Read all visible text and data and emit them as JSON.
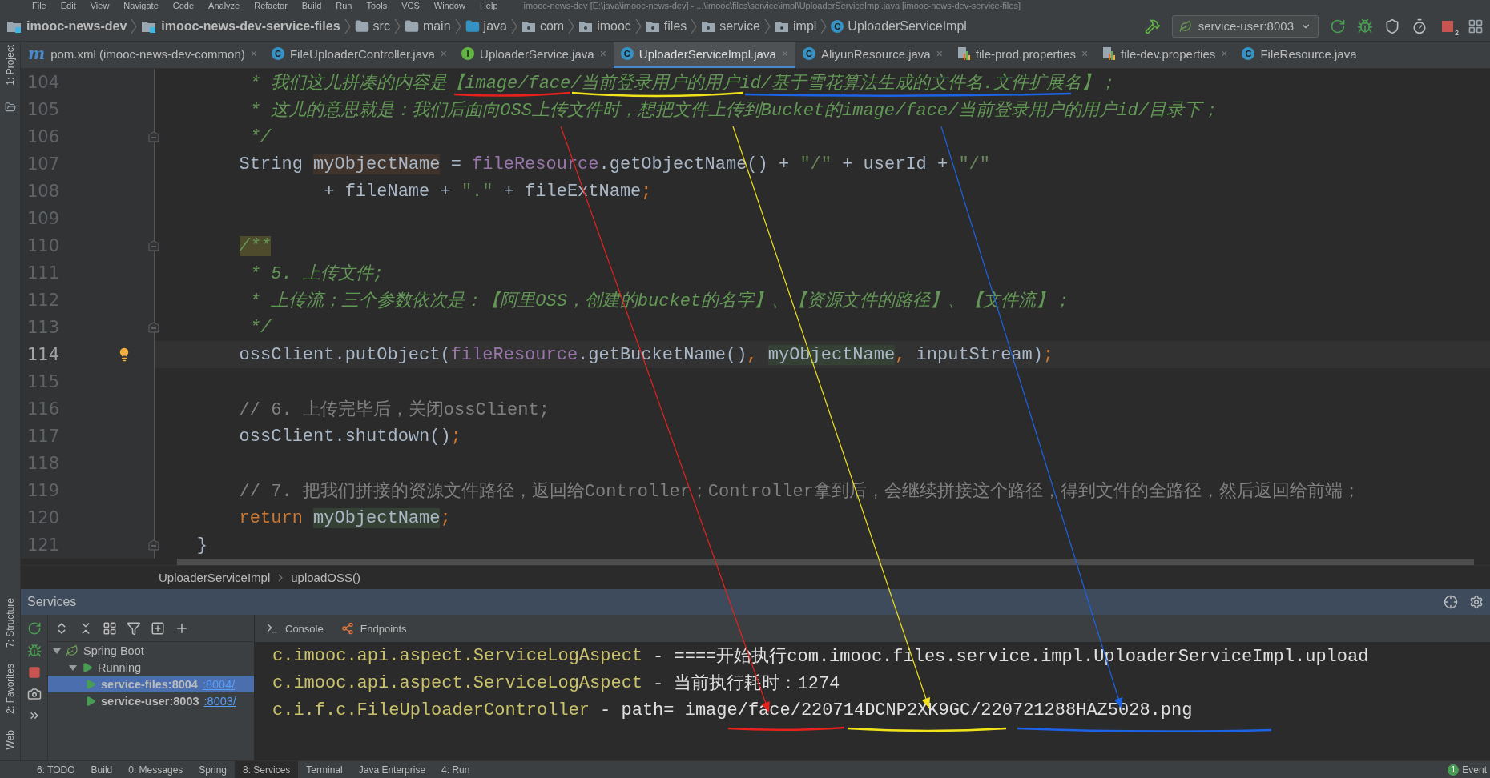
{
  "menu_bar": {
    "items": [
      "File",
      "Edit",
      "View",
      "Navigate",
      "Code",
      "Analyze",
      "Refactor",
      "Build",
      "Run",
      "Tools",
      "VCS",
      "Window",
      "Help"
    ],
    "title": "imooc-news-dev [E:\\java\\imooc-news-dev] - ...\\imooc\\files\\service\\impl\\UploaderServiceImpl.java [imooc-news-dev-service-files]"
  },
  "navigation_bar": {
    "breadcrumbs": [
      {
        "label": "imooc-news-dev",
        "kind": "module"
      },
      {
        "label": "imooc-news-dev-service-files",
        "kind": "module"
      },
      {
        "label": "src",
        "kind": "folder"
      },
      {
        "label": "main",
        "kind": "folder"
      },
      {
        "label": "java",
        "kind": "source"
      },
      {
        "label": "com",
        "kind": "package"
      },
      {
        "label": "imooc",
        "kind": "package"
      },
      {
        "label": "files",
        "kind": "package"
      },
      {
        "label": "service",
        "kind": "package"
      },
      {
        "label": "impl",
        "kind": "package"
      },
      {
        "label": "UploaderServiceImpl",
        "kind": "class",
        "icon": "C"
      }
    ],
    "run_config": "service-user:8003",
    "stop_badge": "2"
  },
  "editor_tabs": [
    {
      "label": "pom.xml (imooc-news-dev-common)",
      "kind": "maven",
      "icon": "m",
      "close": "×",
      "selected": false
    },
    {
      "label": "FileUploaderController.java",
      "kind": "class",
      "icon": "C",
      "close": "×",
      "selected": false
    },
    {
      "label": "UploaderService.java",
      "kind": "interface",
      "icon": "I",
      "close": "×",
      "selected": false
    },
    {
      "label": "UploaderServiceImpl.java",
      "kind": "class",
      "icon": "C",
      "close": "×",
      "selected": true
    },
    {
      "label": "AliyunResource.java",
      "kind": "class",
      "icon": "C",
      "close": "×",
      "selected": false
    },
    {
      "label": "file-prod.properties",
      "kind": "properties",
      "close": "×",
      "selected": false
    },
    {
      "label": "file-dev.properties",
      "kind": "properties",
      "close": "×",
      "selected": false
    },
    {
      "label": "FileResource.java",
      "kind": "class",
      "icon": "C",
      "selected": false
    }
  ],
  "side_stripe": {
    "top": [
      "1: Project"
    ],
    "bottom": [
      "7: Structure",
      "2: Favorites",
      "Web"
    ]
  },
  "editor": {
    "lines": [
      {
        "number": "104",
        "current": false,
        "fold": false,
        "tokens": [
          {
            "kind": "doc",
            "text": "         * 我们这儿拼凑的内容是【image/face/当前登录用户的用户id/基于雪花算法生成的文件名.文件扩展名】；"
          }
        ]
      },
      {
        "number": "105",
        "current": false,
        "fold": false,
        "tokens": [
          {
            "kind": "doc",
            "text": "         * 这儿的意思就是：我们后面向OSS上传文件时，想把文件上传到Bucket的image/face/当前登录用户的用户id/目录下；"
          }
        ]
      },
      {
        "number": "106",
        "current": false,
        "fold": true,
        "tokens": [
          {
            "kind": "doc",
            "text": "         */"
          }
        ]
      },
      {
        "number": "107",
        "current": false,
        "fold": false,
        "tokens": [
          {
            "kind": "plain",
            "text": "        String "
          },
          {
            "kind": "write-usage",
            "text": "myObjectName"
          },
          {
            "kind": "plain",
            "text": " = "
          },
          {
            "kind": "field",
            "text": "fileResource"
          },
          {
            "kind": "plain",
            "text": ".getObjectName() + "
          },
          {
            "kind": "string",
            "text": "\"/\""
          },
          {
            "kind": "plain",
            "text": " + userId + "
          },
          {
            "kind": "string",
            "text": "\"/\""
          }
        ]
      },
      {
        "number": "108",
        "current": false,
        "fold": false,
        "tokens": [
          {
            "kind": "plain",
            "text": "                + fileName + "
          },
          {
            "kind": "string",
            "text": "\".\""
          },
          {
            "kind": "plain",
            "text": " + fileExtName"
          },
          {
            "kind": "punct",
            "text": ";"
          }
        ]
      },
      {
        "number": "109",
        "current": false,
        "fold": false
      },
      {
        "number": "110",
        "current": false,
        "fold": true,
        "tokens": [
          {
            "kind": "doc-start",
            "text": "        /**"
          }
        ]
      },
      {
        "number": "111",
        "current": false,
        "fold": false,
        "tokens": [
          {
            "kind": "doc",
            "text": "         * 5. 上传文件;"
          }
        ]
      },
      {
        "number": "112",
        "current": false,
        "fold": false,
        "tokens": [
          {
            "kind": "doc",
            "text": "         * 上传流；三个参数依次是：【阿里OSS，创建的bucket的名字】、【资源文件的路径】、【文件流】；"
          }
        ]
      },
      {
        "number": "113",
        "current": false,
        "fold": true,
        "tokens": [
          {
            "kind": "doc",
            "text": "         */"
          }
        ]
      },
      {
        "number": "114",
        "current": true,
        "fold": false,
        "tokens": [
          {
            "kind": "plain",
            "text": "        ossClient.putObject("
          },
          {
            "kind": "field",
            "text": "fileResource"
          },
          {
            "kind": "plain",
            "text": ".getBucketName()"
          },
          {
            "kind": "punct",
            "text": ", "
          },
          {
            "kind": "read-usage",
            "text": "myObjectName"
          },
          {
            "kind": "punct",
            "text": ", "
          },
          {
            "kind": "plain",
            "text": "inputStream)"
          },
          {
            "kind": "punct",
            "text": ";"
          }
        ]
      },
      {
        "number": "115",
        "current": false,
        "fold": false
      },
      {
        "number": "116",
        "current": false,
        "fold": false,
        "tokens": [
          {
            "kind": "line-comment",
            "text": "        // 6. 上传完毕后，关闭ossClient;"
          }
        ]
      },
      {
        "number": "117",
        "current": false,
        "fold": false,
        "tokens": [
          {
            "kind": "plain",
            "text": "        ossClient.shutdown()"
          },
          {
            "kind": "punct",
            "text": ";"
          }
        ]
      },
      {
        "number": "118",
        "current": false,
        "fold": false
      },
      {
        "number": "119",
        "current": false,
        "fold": false,
        "tokens": [
          {
            "kind": "line-comment",
            "text": "        // 7. 把我们拼接的资源文件路径，返回给Controller；Controller拿到后，会继续拼接这个路径，得到文件的全路径，然后返回给前端；"
          }
        ]
      },
      {
        "number": "120",
        "current": false,
        "fold": false,
        "tokens": [
          {
            "kind": "keyword",
            "text": "        return "
          },
          {
            "kind": "read-usage",
            "text": "myObjectName"
          },
          {
            "kind": "punct",
            "text": ";"
          }
        ]
      },
      {
        "number": "121",
        "current": false,
        "fold": true,
        "tokens": [
          {
            "kind": "plain",
            "text": "    }"
          }
        ]
      }
    ]
  },
  "annotations": [
    {
      "color": "#e8211d"
    },
    {
      "color": "#f2e21a"
    },
    {
      "color": "#1c63e6"
    }
  ],
  "breadcrumb": [
    "UploaderServiceImpl",
    "uploadOSS()"
  ],
  "services": {
    "title": "Services",
    "tree": [
      {
        "label": "Spring Boot",
        "kind": "group",
        "expanded": true,
        "selected": false,
        "children": [
          {
            "label": "Running",
            "kind": "status",
            "expanded": true,
            "selected": false,
            "children": [
              {
                "label": "service-files:8004",
                "link": ":8004/",
                "kind": "app",
                "selected": true
              },
              {
                "label": "service-user:8003",
                "link": ":8003/",
                "kind": "app",
                "selected": false
              }
            ]
          }
        ]
      }
    ],
    "tabs": [
      {
        "label": "Console",
        "kind": "console"
      },
      {
        "label": "Endpoints",
        "kind": "endpoints"
      }
    ],
    "console": [
      {
        "logger": "c.imooc.api.aspect.ServiceLogAspect",
        "message": "- ====开始执行com.imooc.files.service.impl.UploaderServiceImpl.upload"
      },
      {
        "logger": "c.imooc.api.aspect.ServiceLogAspect",
        "message": "- 当前执行耗时：1274"
      },
      {
        "logger": "c.i.f.c.FileUploaderController",
        "message": "- path= image/face/220714DCNP2XK9GC/220721288HAZ5028.png"
      }
    ]
  },
  "tool_strip": [
    {
      "label": "6: TODO",
      "selected": false
    },
    {
      "label": "Build",
      "selected": false
    },
    {
      "label": "0: Messages",
      "selected": false
    },
    {
      "label": "Spring",
      "selected": false
    },
    {
      "label": "8: Services",
      "selected": true
    },
    {
      "label": "Terminal",
      "selected": false
    },
    {
      "label": "Java Enterprise",
      "selected": false
    },
    {
      "label": "4: Run",
      "selected": false
    }
  ],
  "event_log": {
    "label": "Event",
    "badge": "1"
  }
}
